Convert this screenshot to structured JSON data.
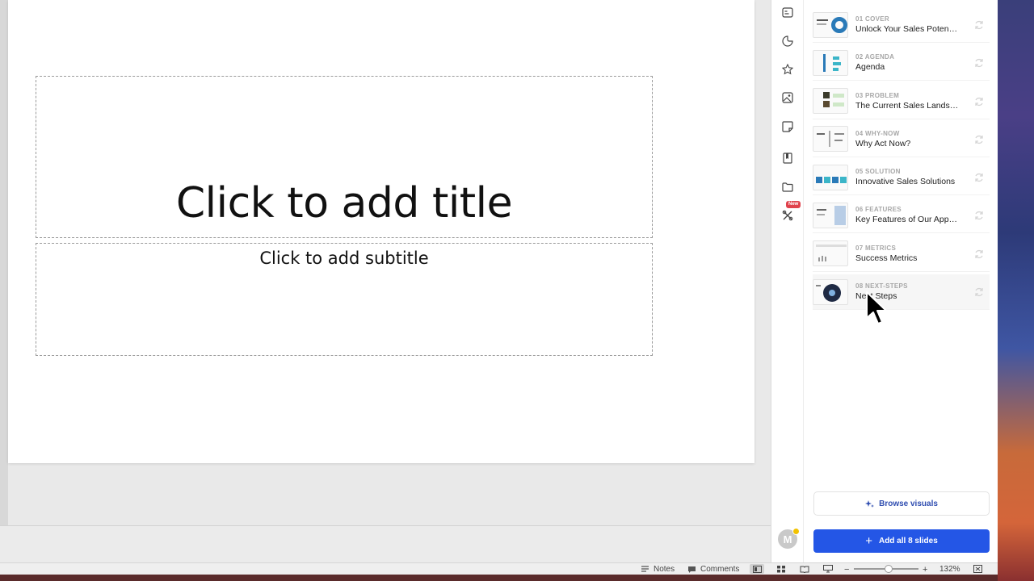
{
  "slide": {
    "title_placeholder": "Click to add title",
    "subtitle_placeholder": "Click to add subtitle"
  },
  "status_bar": {
    "notes_label": "Notes",
    "comments_label": "Comments",
    "zoom_level": "132%"
  },
  "panel": {
    "rail_icons": [
      "layout-icon",
      "sticker-icon",
      "star-icon",
      "image-icon",
      "sticky-note-icon",
      "book-icon",
      "folder-icon",
      "tools-icon"
    ],
    "new_badge": "New",
    "avatar_initial": "M",
    "slides": [
      {
        "tag": "01 COVER",
        "title": "Unlock Your Sales Poten…"
      },
      {
        "tag": "02 AGENDA",
        "title": "Agenda"
      },
      {
        "tag": "03 PROBLEM",
        "title": "The Current Sales Lands…"
      },
      {
        "tag": "04 WHY-NOW",
        "title": "Why Act Now?"
      },
      {
        "tag": "05 SOLUTION",
        "title": "Innovative Sales Solutions"
      },
      {
        "tag": "06 FEATURES",
        "title": "Key Features of Our App…"
      },
      {
        "tag": "07 METRICS",
        "title": "Success Metrics"
      },
      {
        "tag": "08 NEXT-STEPS",
        "title": "Next Steps"
      }
    ],
    "browse_label": "Browse visuals",
    "add_all_label": "Add all 8 slides",
    "colors": {
      "accent": "#2456e6",
      "link": "#2f4db0",
      "badge": "#e0424c"
    }
  }
}
